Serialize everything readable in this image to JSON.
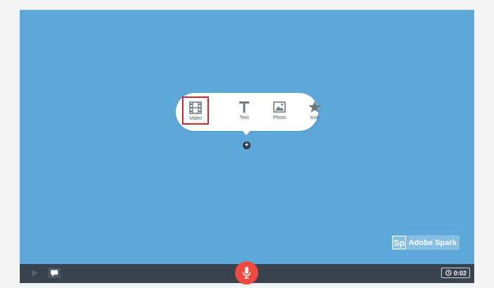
{
  "bubble": {
    "items": [
      {
        "label": "Video",
        "icon": "film-icon"
      },
      {
        "label": "Text",
        "icon": "text-t-icon"
      },
      {
        "label": "Photo",
        "icon": "image-icon"
      },
      {
        "label": "Icon",
        "icon": "star-icon"
      }
    ],
    "add": "+"
  },
  "watermark": {
    "logo": "Sp",
    "text": "Adobe Spark"
  },
  "toolbar": {
    "timer": "0:02"
  },
  "colors": {
    "canvas": "#5ba8d9",
    "toolbar": "#38434e",
    "mic": "#f04a3e",
    "highlight": "#d8232a"
  }
}
